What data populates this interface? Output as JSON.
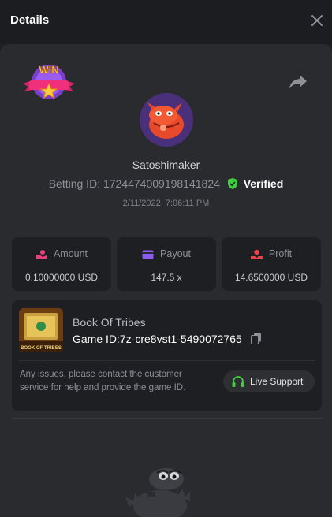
{
  "header": {
    "title": "Details"
  },
  "profile": {
    "username": "Satoshimaker",
    "betting_id_label": "Betting ID: 1724474009198141824",
    "verified_label": "Verified",
    "date": "2/11/2022, 7:06:11 PM",
    "badge_text": "WIN"
  },
  "stats": [
    {
      "label": "Amount",
      "value": "0.10000000 USD"
    },
    {
      "label": "Payout",
      "value": "147.5 x"
    },
    {
      "label": "Profit",
      "value": "14.6500000 USD"
    }
  ],
  "game": {
    "name": "Book Of Tribes",
    "game_id": "Game ID:7z-cre8vst1-5490072765",
    "thumb_text": "BOOK OF TRIBES",
    "issues_text": "Any issues, please contact the customer service for help and provide the game ID.",
    "live_support_label": "Live Support"
  },
  "colors": {
    "accent_green": "#3fcf3f",
    "icon_pink": "#e7407a",
    "icon_purple": "#8a5cf0",
    "icon_red": "#e8424a"
  }
}
